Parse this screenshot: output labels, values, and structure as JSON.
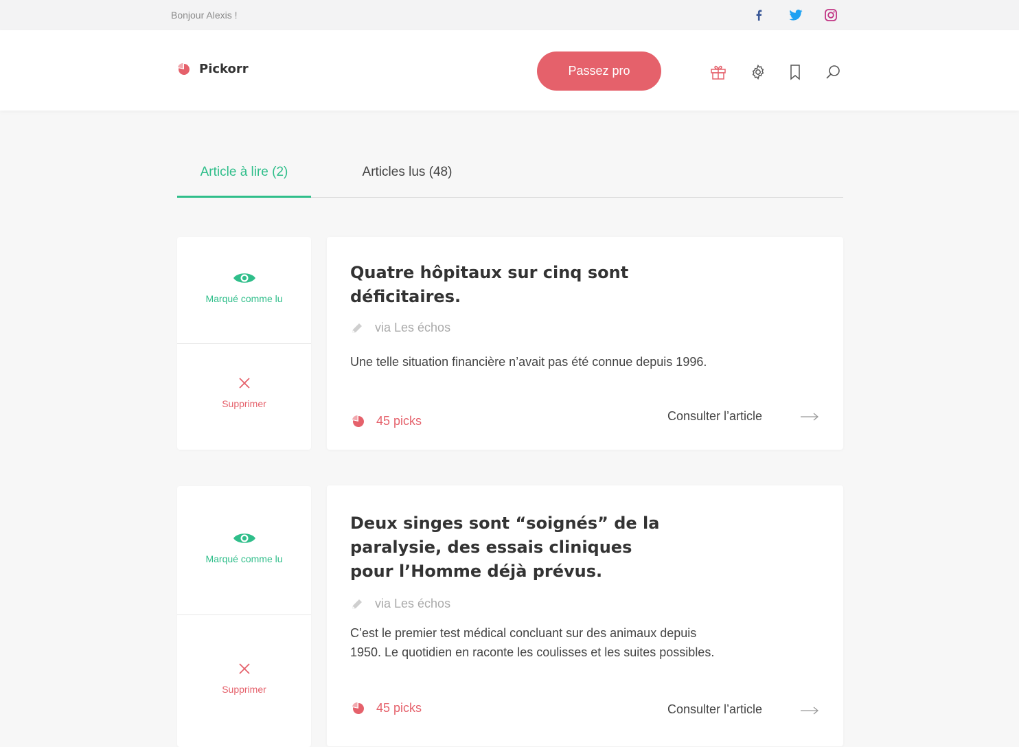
{
  "topbar": {
    "greeting": "Bonjour Alexis !",
    "social": [
      "facebook-icon",
      "twitter-icon",
      "instagram-icon"
    ],
    "colors": {
      "facebook": "#3b5998",
      "twitter": "#1da1f2",
      "instagram": "#c13584"
    }
  },
  "header": {
    "brand": "Pickorr",
    "cta_label": "Passez pro",
    "icons": [
      "gift-icon",
      "gear-icon",
      "bookmark-icon",
      "search-icon"
    ]
  },
  "tabs": [
    {
      "label": "Article à lire (2)",
      "active": true
    },
    {
      "label": "Articles lus (48)",
      "active": false
    }
  ],
  "actions": {
    "mark_read_label": "Marqué comme lu",
    "delete_label": "Supprimer"
  },
  "articles": [
    {
      "title": "Quatre hôpitaux sur cinq sont déficitaires.",
      "source": "via Les échos",
      "description": "Une telle situation financière n’avait pas été connue depuis 1996.",
      "picks": "45 picks",
      "link_label": "Consulter l’article"
    },
    {
      "title": "Deux singes sont “soignés” de la paralysie, des essais cliniques pour l’Homme déjà prévus.",
      "source": "via Les échos",
      "description": "C’est le premier test médical concluant sur des animaux depuis 1950. Le quotidien en raconte les coulisses et les suites possibles.",
      "picks": "45 picks",
      "link_label": "Consulter l’article"
    }
  ],
  "colors": {
    "accent_red": "#e5616b",
    "accent_green": "#2fbe8a",
    "background": "#f7f7f7"
  }
}
